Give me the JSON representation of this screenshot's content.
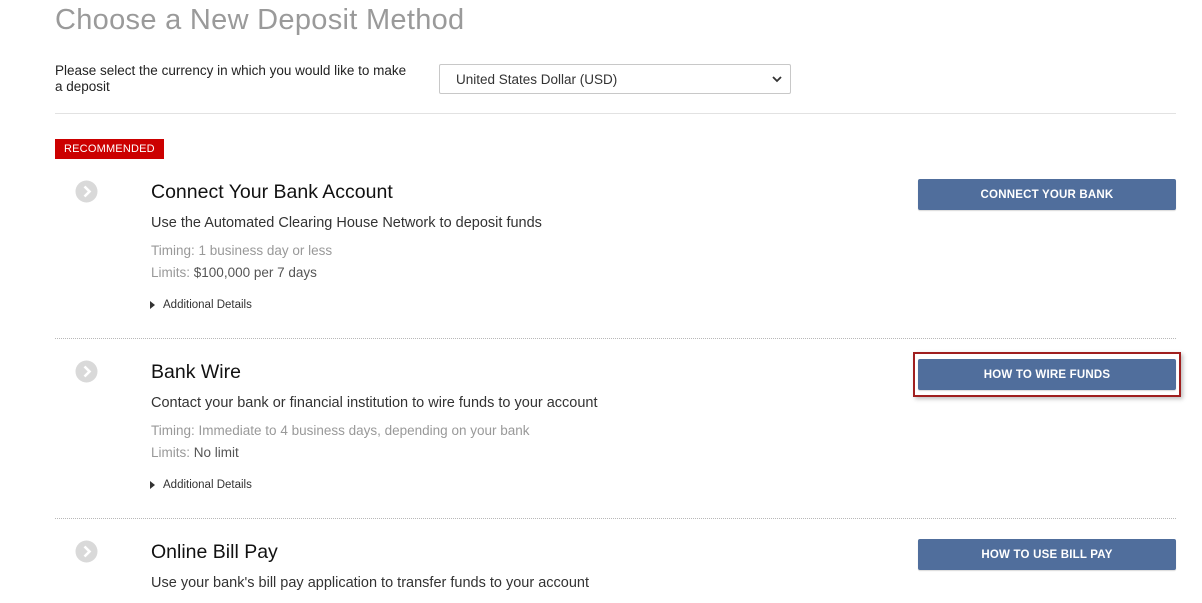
{
  "page_title": "Choose a New Deposit Method",
  "currency": {
    "label": "Please select the currency in which you would like to make a deposit",
    "selected": "United States Dollar (USD)"
  },
  "recommended_label": "RECOMMENDED",
  "methods": [
    {
      "title": "Connect Your Bank Account",
      "description": "Use the Automated Clearing House Network to deposit funds",
      "timing_label": "Timing",
      "timing_value": "1 business day or less",
      "limits_label": "Limits",
      "limits_value": "$100,000 per 7 days",
      "details_label": "Additional Details",
      "button_label": "CONNECT YOUR BANK"
    },
    {
      "title": "Bank Wire",
      "description": "Contact your bank or financial institution to wire funds to your account",
      "timing_label": "Timing",
      "timing_value": "Immediate to 4 business days, depending on your bank",
      "limits_label": "Limits",
      "limits_value": "No limit",
      "details_label": "Additional Details",
      "button_label": "HOW TO WIRE FUNDS"
    },
    {
      "title": "Online Bill Pay",
      "description": "Use your bank's bill pay application to transfer funds to your account",
      "button_label": "HOW TO USE BILL PAY"
    }
  ],
  "colors": {
    "button": "#506e9c",
    "badge": "#cc0000",
    "highlight": "#a01f1f"
  }
}
